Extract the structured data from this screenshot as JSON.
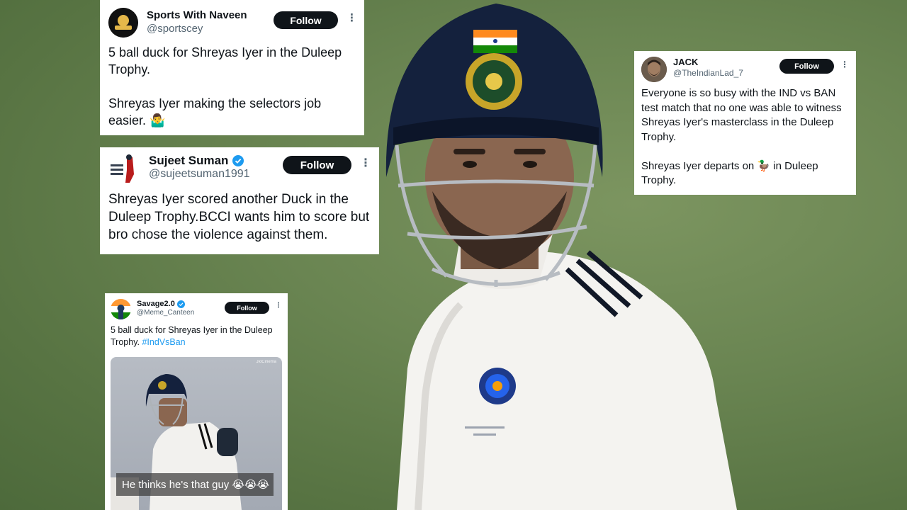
{
  "tweets": [
    {
      "name": "Sports With Naveen",
      "handle": "@sportscey",
      "verified": false,
      "follow_label": "Follow",
      "more_label": "⋮",
      "text": "5 ball duck for Shreyas Iyer in the Duleep Trophy.\n\nShreyas Iyer making the selectors job easier. 🤷‍♂️"
    },
    {
      "name": "Sujeet Suman",
      "handle": "@sujeetsuman1991",
      "verified": true,
      "follow_label": "Follow",
      "more_label": "⋮",
      "text": "Shreyas Iyer scored another Duck in the Duleep Trophy.BCCI wants him to score but bro chose the violence against them."
    },
    {
      "name": "JACK",
      "handle": "@TheIndianLad_7",
      "verified": false,
      "follow_label": "Follow",
      "more_label": "⋮",
      "text": "Everyone is so busy with the IND vs BAN test match that no one was able to witness Shreyas Iyer's masterclass in the Duleep Trophy.\n\nShreyas Iyer departs on 🦆 in Duleep Trophy."
    },
    {
      "name": "Savage2.0",
      "handle": "@Meme_Canteen",
      "verified": true,
      "follow_label": "Follow",
      "more_label": "⋮",
      "text": "5 ball duck for Shreyas Iyer in the Duleep Trophy. ",
      "hashtag": "#IndVsBan",
      "media_caption": "He thinks he's that guy 😭😭😭",
      "media_watermark": "JioCinema"
    }
  ],
  "colors": {
    "follow_bg": "#0f1419",
    "verified": "#1d9bf0",
    "hashtag": "#1d9bf0",
    "helmet": "#14213d",
    "grass": "#6a8552"
  },
  "icons": {
    "verified": "verified-badge-icon",
    "more": "more-options-icon"
  }
}
